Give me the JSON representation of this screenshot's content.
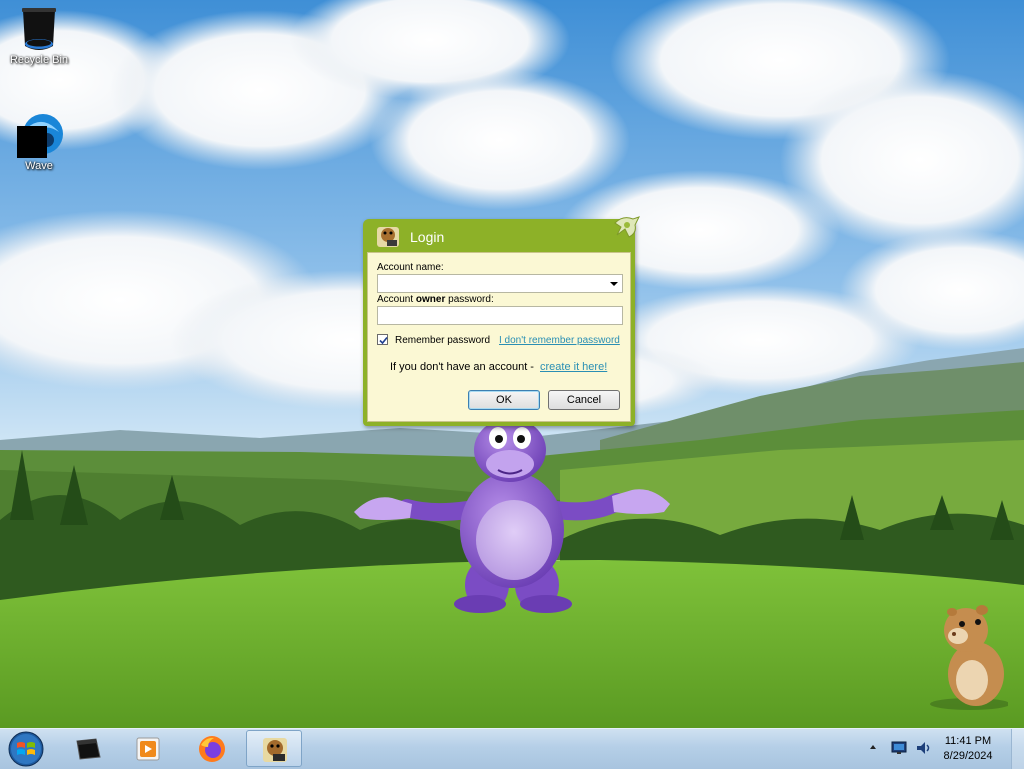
{
  "desktop": {
    "icons": [
      {
        "label": "Recycle Bin",
        "icon": "recycle-bin-icon"
      },
      {
        "label": "Wave",
        "icon": "wave-browser-icon"
      }
    ]
  },
  "login": {
    "title": "Login",
    "account_label": "Account name:",
    "account_value": "",
    "password_label_prefix": "Account ",
    "password_label_bold": "owner",
    "password_label_suffix": " password:",
    "password_value": "",
    "remember_label": "Remember password",
    "remember_checked": true,
    "forgot_link": "I don't remember password",
    "no_account_text": "If you don't have an account - ",
    "create_link": "create it here!",
    "ok_label": "OK",
    "cancel_label": "Cancel"
  },
  "taskbar": {
    "pinned": [
      {
        "name": "start-orb",
        "icon": "windows-logo"
      },
      {
        "name": "cmd",
        "icon": "terminal-icon"
      },
      {
        "name": "media-player",
        "icon": "media-player-icon"
      },
      {
        "name": "firefox",
        "icon": "firefox-icon"
      },
      {
        "name": "bonzi",
        "icon": "bonzi-buddy-icon",
        "active": true
      }
    ],
    "clock": {
      "time": "11:41 PM",
      "date": "8/29/2024"
    }
  },
  "colors": {
    "dialog_green": "#8db128",
    "dialog_body": "#fbf8d4",
    "link": "#2a8fb4",
    "taskbar": "#b5cfe7"
  }
}
